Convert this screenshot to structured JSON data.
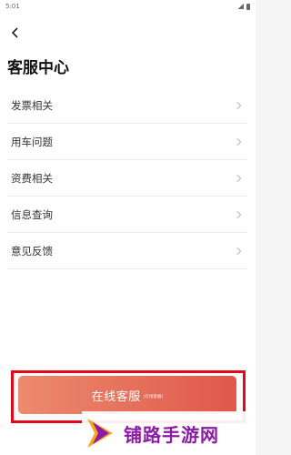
{
  "status_bar": {
    "time": "5:01"
  },
  "header": {
    "back_icon": "chevron-left-icon",
    "title": "客服中心"
  },
  "menu": {
    "items": [
      {
        "label": "发票相关"
      },
      {
        "label": "用车问题"
      },
      {
        "label": "资费相关"
      },
      {
        "label": "信息查询"
      },
      {
        "label": "意见反馈"
      }
    ]
  },
  "footer": {
    "online_service_label": "在线客服",
    "online_service_note": "(在线客服)"
  },
  "watermark": {
    "text": "铺路手游网"
  },
  "colors": {
    "button_gradient_start": "#ec8a6e",
    "button_gradient_end": "#e0584a",
    "highlight_border": "#e1091b",
    "watermark_text": "#8c1aa6"
  }
}
